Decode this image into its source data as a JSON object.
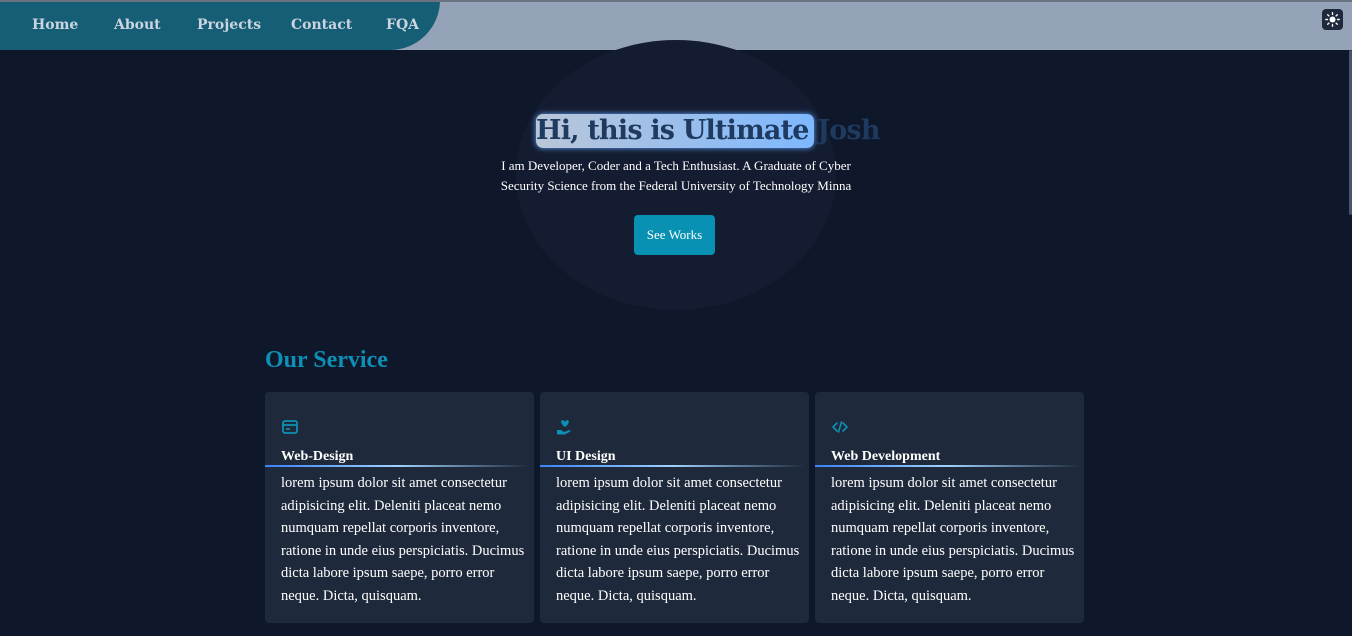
{
  "nav": {
    "items": [
      {
        "label": "Home"
      },
      {
        "label": "About"
      },
      {
        "label": "Projects"
      },
      {
        "label": "Contact"
      },
      {
        "label": "FQA"
      }
    ]
  },
  "hero": {
    "title": "Hi, this is Ultimate Josh",
    "description": "I am Developer, Coder and a Tech Enthusiast. A Graduate of Cyber Security Science from the Federal University of Technology Minna",
    "button_label": "See Works"
  },
  "services": {
    "title": "Our Service",
    "cards": [
      {
        "icon": "browser-window-icon",
        "title": "Web-Design",
        "body": "lorem ipsum dolor sit amet consectetur adipisicing elit. Deleniti placeat nemo numquam repellat corporis inventore, ratione in unde eius perspiciatis. Ducimus dicta labore ipsum saepe, porro error neque. Dicta, quisquam."
      },
      {
        "icon": "hand-heart-icon",
        "title": "UI Design",
        "body": "lorem ipsum dolor sit amet consectetur adipisicing elit. Deleniti placeat nemo numquam repellat corporis inventore, ratione in unde eius perspiciatis. Ducimus dicta labore ipsum saepe, porro error neque. Dicta, quisquam."
      },
      {
        "icon": "code-icon",
        "title": "Web Development",
        "body": "lorem ipsum dolor sit amet consectetur adipisicing elit. Deleniti placeat nemo numquam repellat corporis inventore, ratione in unde eius perspiciatis. Ducimus dicta labore ipsum saepe, porro error neque. Dicta, quisquam."
      }
    ]
  },
  "colors": {
    "background": "#0f172a",
    "nav_pill": "#155e75",
    "navbar": "#94a3b8",
    "accent": "#0891b2",
    "card": "#1e293b"
  },
  "theme_toggle": {
    "icon": "sun-icon"
  }
}
